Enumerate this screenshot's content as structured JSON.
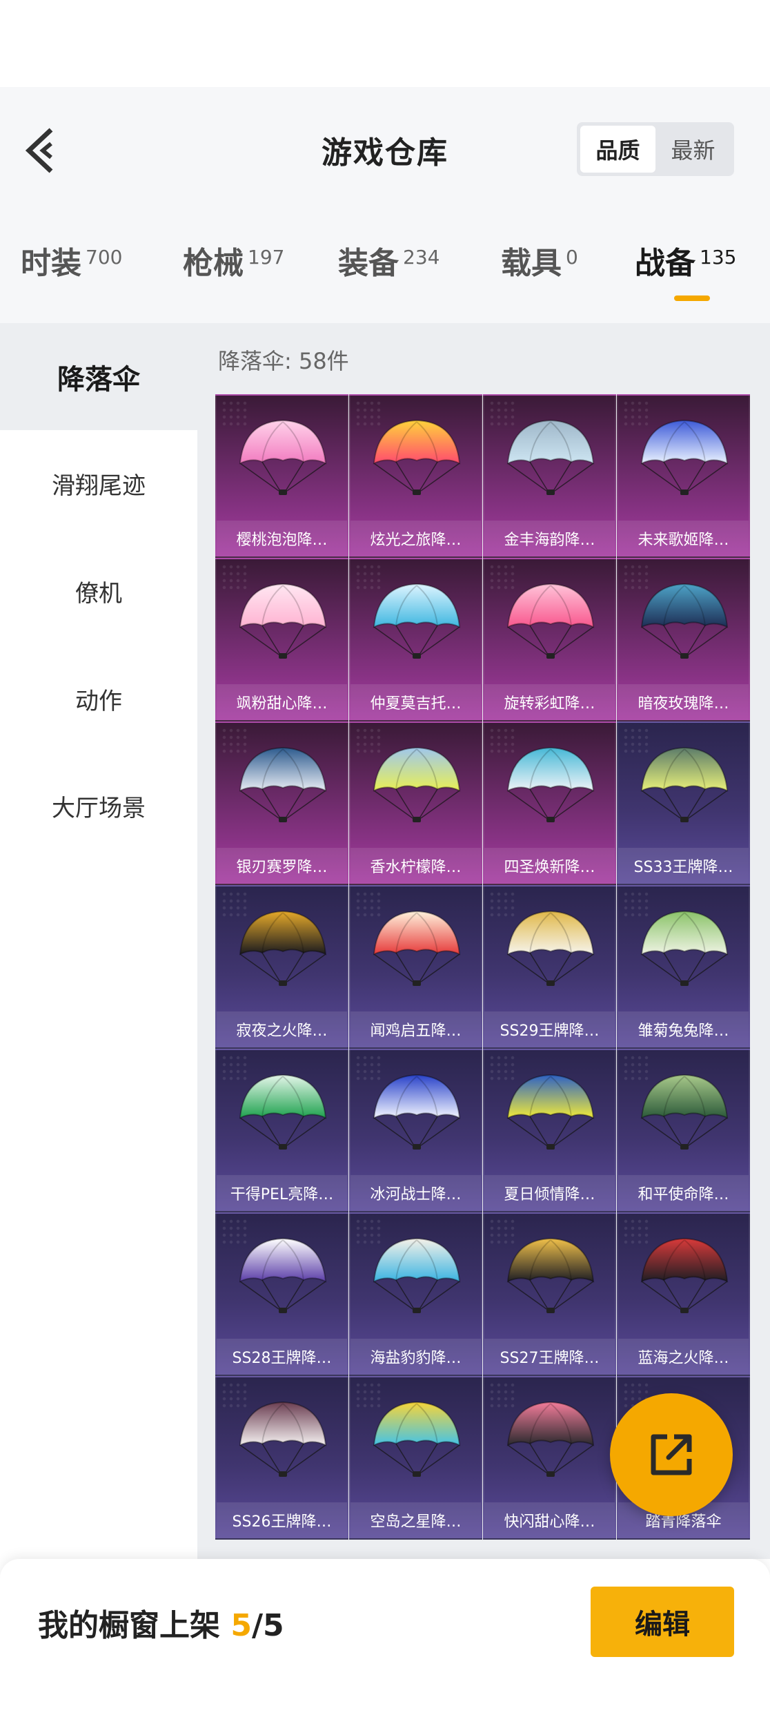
{
  "header": {
    "title": "游戏仓库",
    "sort_options": [
      {
        "label": "品质",
        "active": true
      },
      {
        "label": "最新",
        "active": false
      }
    ]
  },
  "category_tabs": [
    {
      "label": "时装",
      "count": "700",
      "active": false
    },
    {
      "label": "枪械",
      "count": "197",
      "active": false
    },
    {
      "label": "装备",
      "count": "234",
      "active": false
    },
    {
      "label": "载具",
      "count": "0",
      "active": false
    },
    {
      "label": "战备",
      "count": "135",
      "active": true
    }
  ],
  "sidebar": {
    "items": [
      {
        "label": "降落伞",
        "active": true
      },
      {
        "label": "滑翔尾迹",
        "active": false
      },
      {
        "label": "僚机",
        "active": false
      },
      {
        "label": "动作",
        "active": false
      },
      {
        "label": "大厅场景",
        "active": false
      }
    ]
  },
  "content": {
    "count_text": "降落伞: 58件",
    "items": [
      {
        "name": "樱桃泡泡降…",
        "tier": "pink",
        "colors": [
          "#f27cc0",
          "#ffd2ea"
        ]
      },
      {
        "name": "炫光之旅降…",
        "tier": "pink",
        "colors": [
          "#ff4b6e",
          "#ffd23c"
        ]
      },
      {
        "name": "金丰海韵降…",
        "tier": "pink",
        "colors": [
          "#cde5f2",
          "#9fb7c9"
        ]
      },
      {
        "name": "未来歌姬降…",
        "tier": "pink",
        "colors": [
          "#eaf2ff",
          "#3e5bd8"
        ]
      },
      {
        "name": "飒粉甜心降…",
        "tier": "pink",
        "colors": [
          "#ffb3d2",
          "#ffe7f2"
        ]
      },
      {
        "name": "仲夏莫吉托…",
        "tier": "pink",
        "colors": [
          "#3fb7e0",
          "#ddf4ff"
        ]
      },
      {
        "name": "旋转彩虹降…",
        "tier": "pink",
        "colors": [
          "#f8588e",
          "#ffc3d9"
        ]
      },
      {
        "name": "暗夜玫瑰降…",
        "tier": "pink",
        "colors": [
          "#1e2e55",
          "#4da3c7"
        ]
      },
      {
        "name": "银刃赛罗降…",
        "tier": "pink",
        "colors": [
          "#e8ecf4",
          "#2d5b8e"
        ]
      },
      {
        "name": "香水柠檬降…",
        "tier": "pink",
        "colors": [
          "#e8ef56",
          "#9fc7ec"
        ]
      },
      {
        "name": "四圣焕新降…",
        "tier": "pink",
        "colors": [
          "#eef3f7",
          "#46b8d6"
        ]
      },
      {
        "name": "SS33王牌降…",
        "tier": "blue",
        "colors": [
          "#e8f07a",
          "#5c7c6a"
        ]
      },
      {
        "name": "寂夜之火降…",
        "tier": "blue",
        "colors": [
          "#1b1b1f",
          "#e5a92a"
        ]
      },
      {
        "name": "闻鸡启五降…",
        "tier": "blue",
        "colors": [
          "#e63b3b",
          "#fff2dc"
        ]
      },
      {
        "name": "SS29王牌降…",
        "tier": "blue",
        "colors": [
          "#f6f4ec",
          "#e0b84a"
        ]
      },
      {
        "name": "雏菊兔兔降…",
        "tier": "blue",
        "colors": [
          "#eef3e3",
          "#8bc36a"
        ]
      },
      {
        "name": "干得PEL亮降…",
        "tier": "blue",
        "colors": [
          "#1fa24f",
          "#e4f6e9"
        ]
      },
      {
        "name": "冰河战士降…",
        "tier": "blue",
        "colors": [
          "#f2f5ff",
          "#2a43c9"
        ]
      },
      {
        "name": "夏日倾情降…",
        "tier": "blue",
        "colors": [
          "#f0ea3a",
          "#2e62c4"
        ]
      },
      {
        "name": "和平使命降…",
        "tier": "blue",
        "colors": [
          "#2c5a3a",
          "#a8c98a"
        ]
      },
      {
        "name": "SS28王牌降…",
        "tier": "blue",
        "colors": [
          "#5b3ea8",
          "#ffffff"
        ]
      },
      {
        "name": "海盐豹豹降…",
        "tier": "blue",
        "colors": [
          "#3ab4e2",
          "#f5f1e8"
        ]
      },
      {
        "name": "SS27王牌降…",
        "tier": "blue",
        "colors": [
          "#1e1e24",
          "#f0c04a"
        ]
      },
      {
        "name": "蓝海之火降…",
        "tier": "blue",
        "colors": [
          "#1e1e24",
          "#d83a3a"
        ]
      },
      {
        "name": "SS26王牌降…",
        "tier": "blue",
        "colors": [
          "#f4f0f0",
          "#6b3e52"
        ]
      },
      {
        "name": "空岛之星降…",
        "tier": "blue",
        "colors": [
          "#45c3e6",
          "#f6d43a"
        ]
      },
      {
        "name": "快闪甜心降…",
        "tier": "blue",
        "colors": [
          "#2a2a2e",
          "#f27c9a"
        ]
      },
      {
        "name": "踏青降落伞",
        "tier": "blue",
        "colors": [
          "#58b346",
          "#e6f2d8"
        ]
      }
    ]
  },
  "showcase": {
    "prefix": "我的橱窗上架 ",
    "current": "5",
    "total": "/5"
  },
  "edit_label": "编辑"
}
